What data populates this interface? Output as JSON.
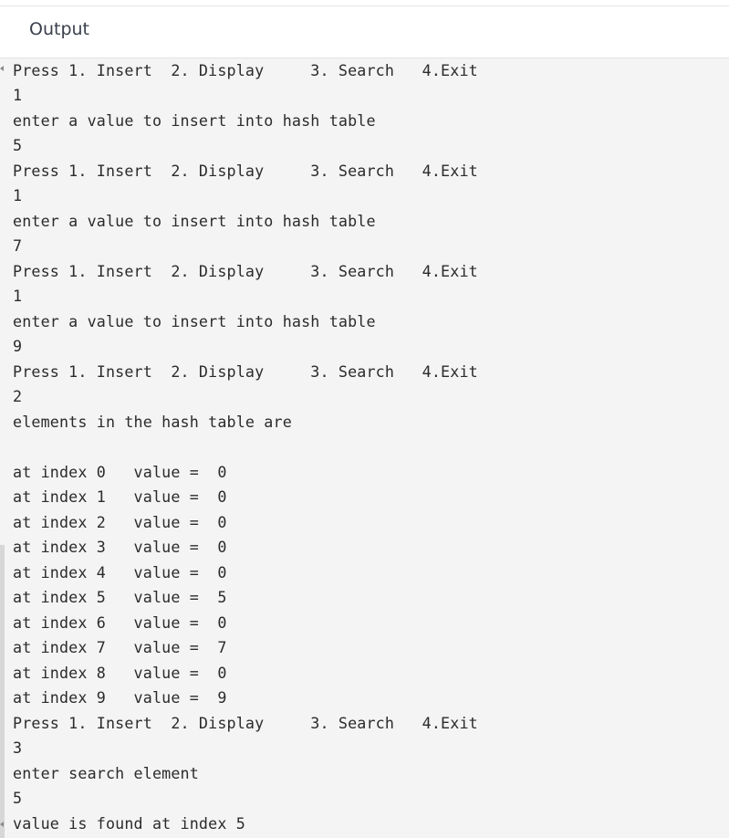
{
  "header": {
    "title": "Output"
  },
  "console": {
    "lines": [
      "Press 1. Insert  2. Display     3. Search   4.Exit",
      "1",
      "enter a value to insert into hash table",
      "5",
      "Press 1. Insert  2. Display     3. Search   4.Exit",
      "1",
      "enter a value to insert into hash table",
      "7",
      "Press 1. Insert  2. Display     3. Search   4.Exit",
      "1",
      "enter a value to insert into hash table",
      "9",
      "Press 1. Insert  2. Display     3. Search   4.Exit",
      "2",
      "elements in the hash table are",
      "",
      "at index 0   value =  0",
      "at index 1   value =  0",
      "at index 2   value =  0",
      "at index 3   value =  0",
      "at index 4   value =  0",
      "at index 5   value =  5",
      "at index 6   value =  0",
      "at index 7   value =  7",
      "at index 8   value =  0",
      "at index 9   value =  9",
      "Press 1. Insert  2. Display     3. Search   4.Exit",
      "3",
      "enter search element",
      "5",
      "value is found at index 5"
    ]
  }
}
